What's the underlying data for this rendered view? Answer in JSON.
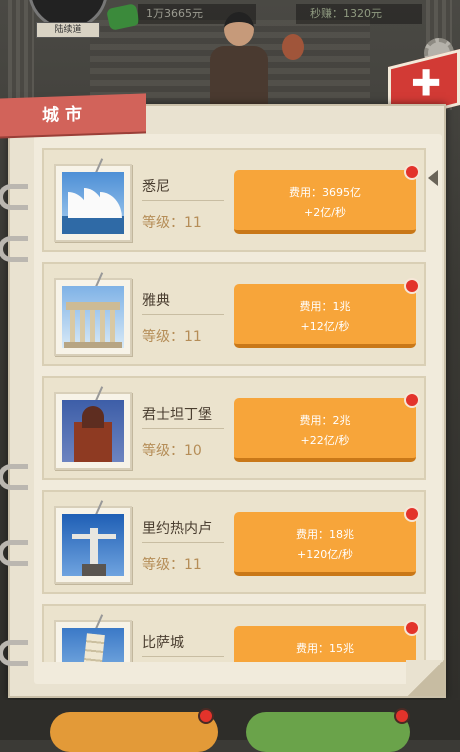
{
  "hud": {
    "level_label": "陆续道",
    "money": "1万3665元",
    "rate": "秒赚：1320元"
  },
  "panel": {
    "title": "城市"
  },
  "cities": [
    {
      "name": "悉尼",
      "level": "等级：11",
      "cost": "费用：3695亿",
      "income": "+2亿/秒"
    },
    {
      "name": "雅典",
      "level": "等级：11",
      "cost": "费用：1兆",
      "income": "+12亿/秒"
    },
    {
      "name": "君士坦丁堡",
      "level": "等级：10",
      "cost": "费用：2兆",
      "income": "+22亿/秒"
    },
    {
      "name": "里约热内卢",
      "level": "等级：11",
      "cost": "费用：18兆",
      "income": "+120亿/秒"
    },
    {
      "name": "比萨城",
      "level": "",
      "cost": "费用：15兆",
      "income": ""
    }
  ],
  "colors": {
    "ribbon": "#d2635a",
    "button": "#f7a53a",
    "close": "#d23a35",
    "badge": "#e3332b"
  }
}
